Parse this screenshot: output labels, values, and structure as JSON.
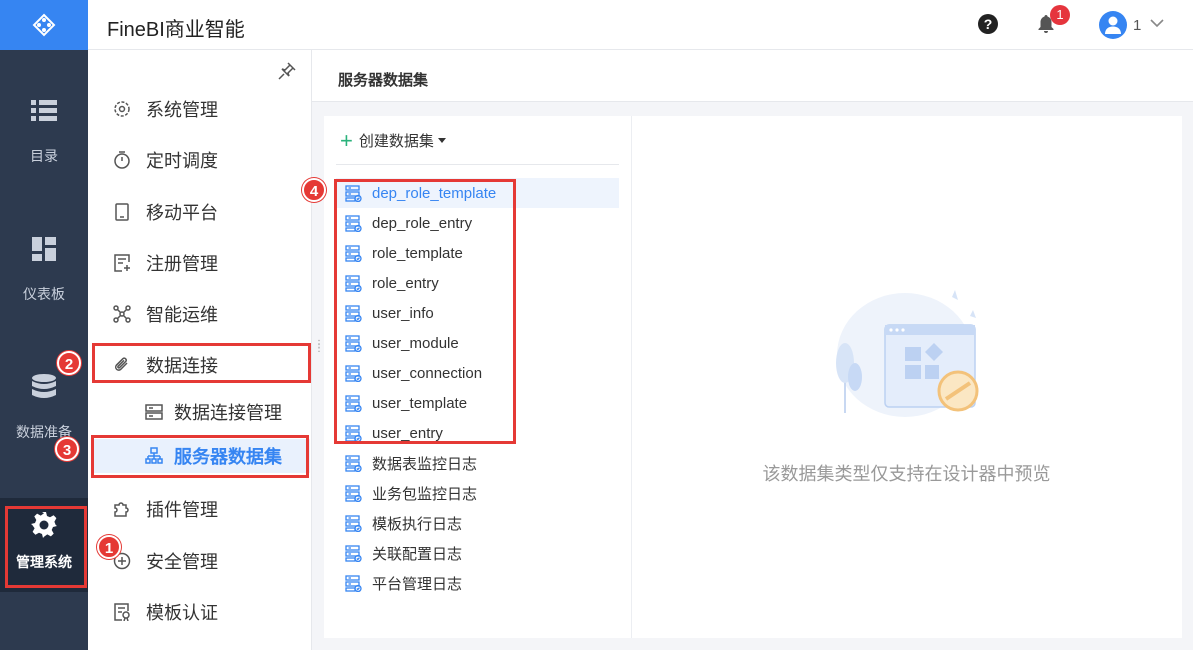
{
  "rail": {
    "items": [
      {
        "label": "目录"
      },
      {
        "label": "仪表板"
      },
      {
        "label": "数据准备"
      },
      {
        "label": "管理系统"
      }
    ]
  },
  "header": {
    "title": "FineBI商业智能",
    "notification_count": "1",
    "user_name": "1"
  },
  "nav": {
    "items": [
      {
        "label": "系统管理"
      },
      {
        "label": "定时调度"
      },
      {
        "label": "移动平台"
      },
      {
        "label": "注册管理"
      },
      {
        "label": "智能运维"
      },
      {
        "label": "数据连接"
      },
      {
        "label": "插件管理"
      },
      {
        "label": "安全管理"
      },
      {
        "label": "模板认证"
      }
    ],
    "sub_items": [
      {
        "label": "数据连接管理"
      },
      {
        "label": "服务器数据集"
      }
    ]
  },
  "main": {
    "title": "服务器数据集",
    "create_label": "创建数据集",
    "datasets": [
      "dep_role_template",
      "dep_role_entry",
      "role_template",
      "role_entry",
      "user_info",
      "user_module",
      "user_connection",
      "user_template",
      "user_entry",
      "数据表监控日志",
      "业务包监控日志",
      "模板执行日志",
      "关联配置日志",
      "平台管理日志"
    ],
    "empty_text": "该数据集类型仅支持在设计器中预览"
  },
  "steps": [
    "1",
    "2",
    "3",
    "4"
  ],
  "colors": {
    "accent": "#3685f2",
    "rail": "#2d3a4f",
    "highlight": "#e53935"
  }
}
